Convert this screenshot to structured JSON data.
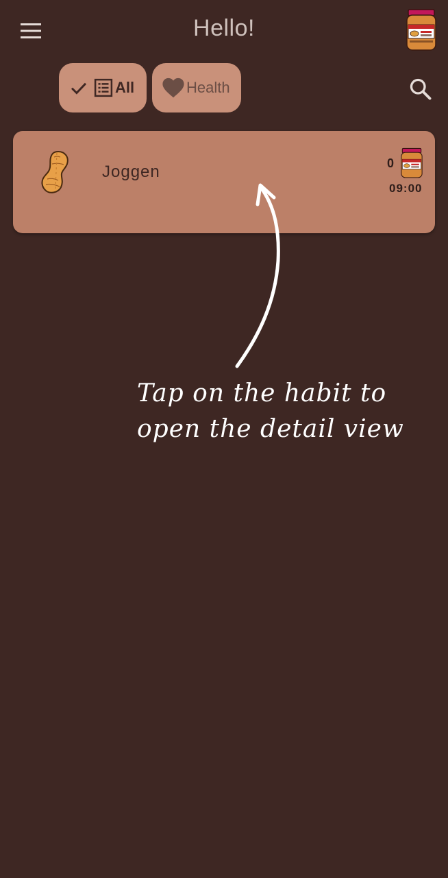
{
  "app": {
    "title": "Hello!"
  },
  "filters": {
    "all_label": "All",
    "health_label": "Health"
  },
  "habits": [
    {
      "name": "Joggen",
      "streak": "0",
      "time": "09:00"
    }
  ],
  "hint": {
    "line1": "Tap on the habit to",
    "line2": "open the detail view"
  },
  "colors": {
    "background": "#3e2723",
    "chip": "#c9917a",
    "card": "#bc8068",
    "accent": "#e0a040"
  },
  "icons": {
    "menu": "menu-icon",
    "avatar": "peanut-butter-jar-icon",
    "check": "check-icon",
    "list": "list-icon",
    "heart": "heart-icon",
    "search": "search-icon",
    "habit": "peanut-icon",
    "streak": "peanut-butter-jar-icon"
  }
}
